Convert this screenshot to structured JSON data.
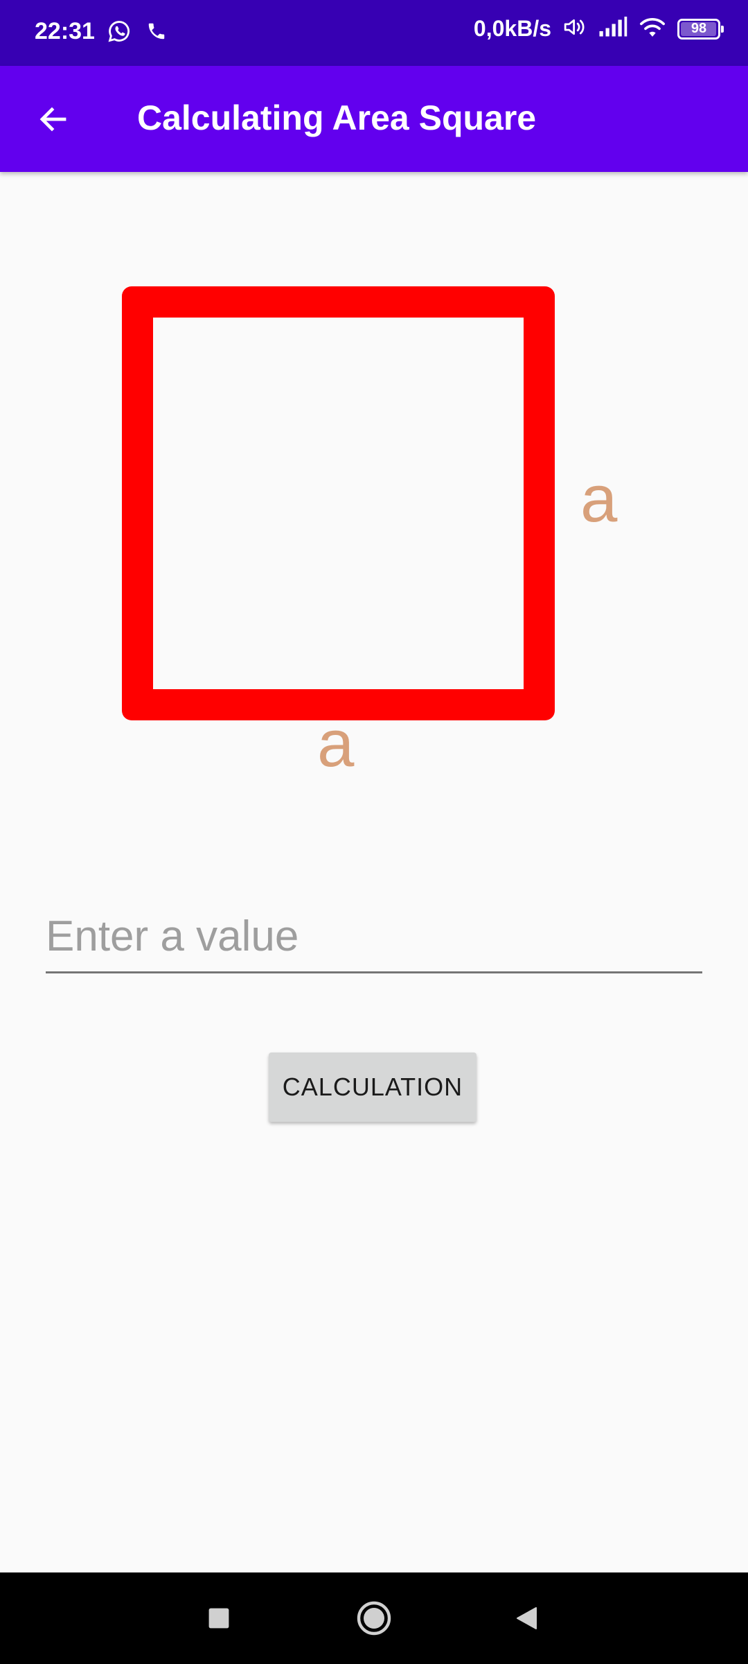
{
  "status_bar": {
    "time": "22:31",
    "net_speed": "0,0kB/s",
    "battery_level": "98",
    "icons": [
      "whatsapp-icon",
      "phone-icon",
      "volume-icon",
      "signal-icon",
      "wifi-icon",
      "battery-icon"
    ]
  },
  "app_bar": {
    "title": "Calculating Area Square",
    "back_icon": "arrow-back-icon"
  },
  "figure": {
    "side_right_label": "a",
    "side_bottom_label": "a",
    "square_color": "#ff0000",
    "label_color": "#d8a07a"
  },
  "form": {
    "input_placeholder": "Enter a value",
    "input_value": "",
    "button_label": "CALCULATION"
  },
  "colors": {
    "status_bar": "#3700b3",
    "app_bar": "#6200ee",
    "background": "#fafafa",
    "button": "#d6d7d7"
  },
  "nav_bar": {
    "icons": [
      "recents-icon",
      "home-icon",
      "back-icon"
    ]
  }
}
